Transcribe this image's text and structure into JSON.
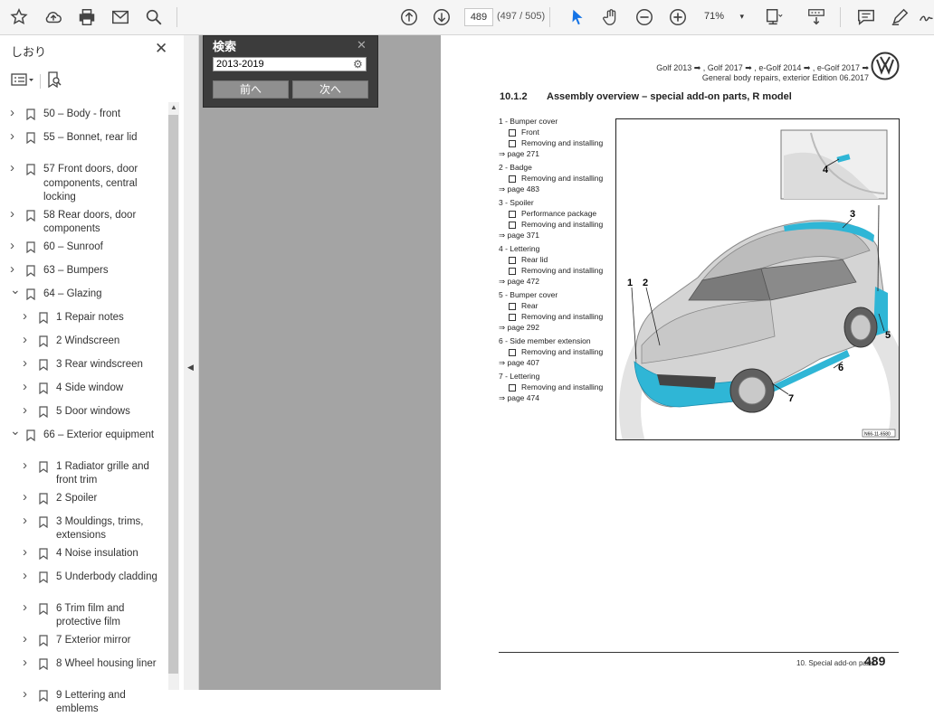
{
  "toolbar": {
    "page_current": "489",
    "page_count": "(497 / 505)",
    "zoom": "71%",
    "icons": [
      "star-icon",
      "cloud-upload-icon",
      "print-icon",
      "mail-icon",
      "search-icon",
      "page-up-icon",
      "page-down-icon",
      "select-cursor-icon",
      "hand-tool-icon",
      "zoom-out-icon",
      "zoom-in-icon",
      "fit-page-icon",
      "scroll-mode-icon",
      "comment-icon",
      "highlight-pen-icon",
      "sign-icon"
    ]
  },
  "sidebar": {
    "title": "しおり",
    "items": [
      {
        "label": "50 – Body - front",
        "level": 0,
        "expanded": false
      },
      {
        "label": "55 – Bonnet, rear lid",
        "level": 0,
        "expanded": false
      },
      {
        "label": "57    Front doors, door components, central locking",
        "level": 0,
        "expanded": false
      },
      {
        "label": "58    Rear doors, door components",
        "level": 0,
        "expanded": false
      },
      {
        "label": "60 – Sunroof",
        "level": 0,
        "expanded": false
      },
      {
        "label": "63 – Bumpers",
        "level": 0,
        "expanded": false
      },
      {
        "label": "64 – Glazing",
        "level": 0,
        "expanded": true
      },
      {
        "label": "1 Repair notes",
        "level": 1,
        "expanded": false
      },
      {
        "label": "2 Windscreen",
        "level": 1,
        "expanded": false
      },
      {
        "label": "3 Rear windscreen",
        "level": 1,
        "expanded": false
      },
      {
        "label": "4 Side window",
        "level": 1,
        "expanded": false
      },
      {
        "label": "5 Door windows",
        "level": 1,
        "expanded": false
      },
      {
        "label": "66 – Exterior equipment",
        "level": 0,
        "expanded": true
      },
      {
        "label": "1 Radiator grille and front trim",
        "level": 1,
        "expanded": false
      },
      {
        "label": "2 Spoiler",
        "level": 1,
        "expanded": false
      },
      {
        "label": "3 Mouldings, trims, extensions",
        "level": 1,
        "expanded": false
      },
      {
        "label": "4 Noise insulation",
        "level": 1,
        "expanded": false
      },
      {
        "label": "5 Underbody cladding",
        "level": 1,
        "expanded": false
      },
      {
        "label": "6 Trim film and protective film",
        "level": 1,
        "expanded": false
      },
      {
        "label": "7 Exterior mirror",
        "level": 1,
        "expanded": false
      },
      {
        "label": "8 Wheel housing liner",
        "level": 1,
        "expanded": false
      },
      {
        "label": "9 Lettering and emblems",
        "level": 1,
        "expanded": false
      }
    ]
  },
  "find": {
    "title": "検索",
    "query": "2013-2019",
    "prev": "前へ",
    "next": "次へ"
  },
  "page": {
    "header_line1": "Golf 2013 ➡ , Golf 2017 ➡ , e-Golf 2014 ➡ , e-Golf 2017 ➡",
    "header_line2": "General body repairs, exterior    Edition 06.2017",
    "section_number": "10.1.2",
    "section_title": "Assembly overview – special add-on parts, R model",
    "legend": [
      {
        "type": "h",
        "text": "1 - Bumper cover"
      },
      {
        "type": "b",
        "text": "Front"
      },
      {
        "type": "b",
        "text": "Removing and installing"
      },
      {
        "type": "l",
        "text": "⇒ page 271"
      },
      {
        "type": "h",
        "text": "2 - Badge"
      },
      {
        "type": "b",
        "text": "Removing and installing"
      },
      {
        "type": "l",
        "text": "⇒ page 483"
      },
      {
        "type": "h",
        "text": "3 - Spoiler"
      },
      {
        "type": "b",
        "text": "Performance package"
      },
      {
        "type": "b",
        "text": "Removing and installing"
      },
      {
        "type": "l",
        "text": "⇒ page 371"
      },
      {
        "type": "h",
        "text": "4 - Lettering"
      },
      {
        "type": "b",
        "text": "Rear lid"
      },
      {
        "type": "b",
        "text": "Removing and installing"
      },
      {
        "type": "l",
        "text": "⇒ page 472"
      },
      {
        "type": "h",
        "text": "5 - Bumper cover"
      },
      {
        "type": "b",
        "text": "Rear"
      },
      {
        "type": "b",
        "text": "Removing and installing"
      },
      {
        "type": "l",
        "text": "⇒ page 292"
      },
      {
        "type": "h",
        "text": "6 - Side member extension"
      },
      {
        "type": "b",
        "text": "Removing and installing"
      },
      {
        "type": "l",
        "text": "⇒ page 407"
      },
      {
        "type": "h",
        "text": "7 - Lettering"
      },
      {
        "type": "b",
        "text": "Removing and installing"
      },
      {
        "type": "l",
        "text": "⇒ page 474"
      }
    ],
    "callouts": [
      "1",
      "2",
      "3",
      "4",
      "5",
      "6",
      "7"
    ],
    "figure_code": "N66-11-6580",
    "footer_text": "10. Special add-on parts",
    "footer_page": "489",
    "accent": "#2fb6d6"
  }
}
